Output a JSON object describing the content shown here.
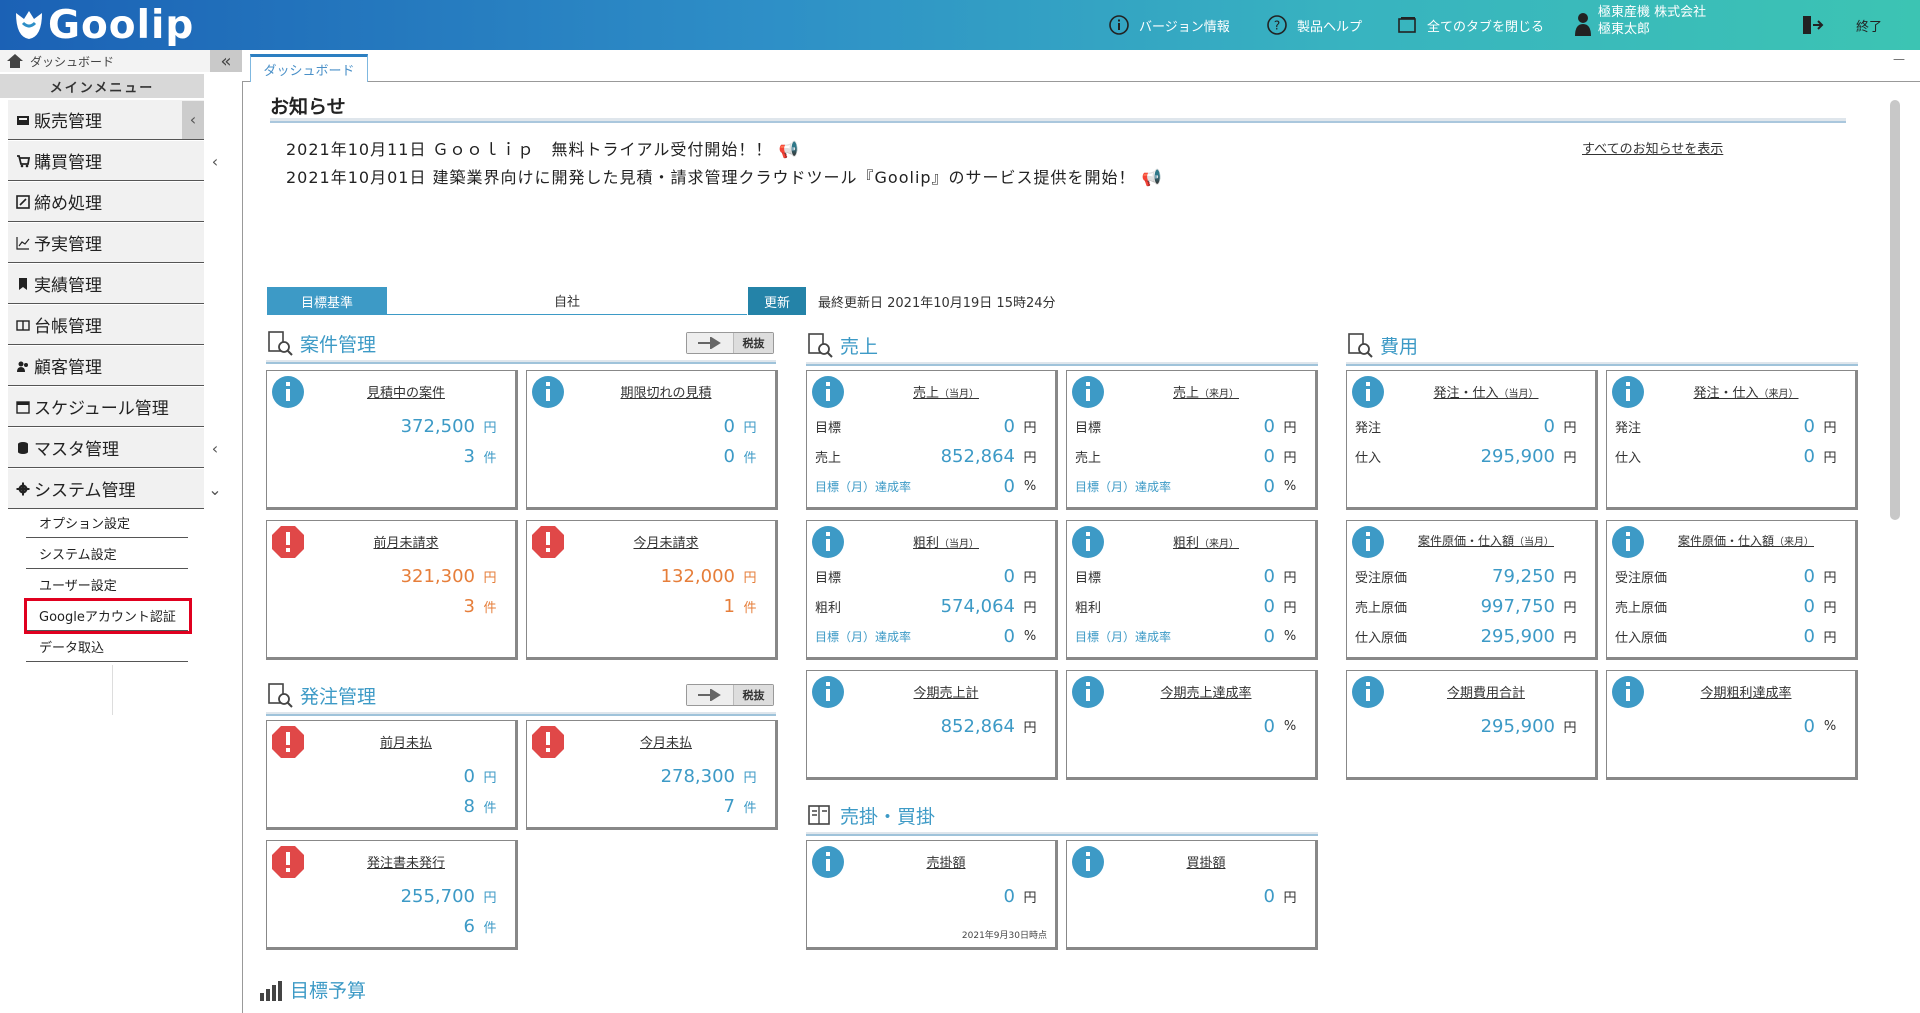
{
  "header": {
    "logo": "Goolip",
    "version_info": "バージョン情報",
    "product_help": "製品ヘルプ",
    "close_all_tabs": "全てのタブを閉じる",
    "company": "極東産機 株式会社",
    "user": "極東太郎",
    "exit": "終了"
  },
  "sidebar": {
    "dashboard_link": "ダッシュボード",
    "menu_title": "メインメニュー",
    "items": [
      {
        "label": "販売管理"
      },
      {
        "label": "購買管理"
      },
      {
        "label": "締め処理"
      },
      {
        "label": "予実管理"
      },
      {
        "label": "実績管理"
      },
      {
        "label": "台帳管理"
      },
      {
        "label": "顧客管理"
      },
      {
        "label": "スケジュール管理"
      },
      {
        "label": "マスタ管理"
      },
      {
        "label": "システム管理"
      }
    ],
    "sub_items": [
      {
        "label": "オプション設定"
      },
      {
        "label": "システム設定"
      },
      {
        "label": "ユーザー設定"
      },
      {
        "label": "Googleアカウント認証"
      },
      {
        "label": "データ取込"
      }
    ]
  },
  "tabs": [
    {
      "label": "ダッシュボード"
    }
  ],
  "notices": {
    "title": "お知らせ",
    "items": [
      "2021年10月11日 Ｇｏｏｌｉｐ　無料トライアル受付開始！！",
      "2021年10月01日 建築業界向けに開発した見積・請求管理クラウドツール『Goolip』のサービス提供を開始！"
    ],
    "show_all": "すべてのお知らせを表示"
  },
  "target": {
    "base_label": "目標基準",
    "self_label": "自社",
    "update_button": "更新",
    "last_updated": "最終更新日 2021年10月19日 15時24分"
  },
  "sections": {
    "projects": {
      "title": "案件管理",
      "tax": "税抜"
    },
    "orders": {
      "title": "発注管理",
      "tax": "税抜"
    },
    "sales": {
      "title": "売上"
    },
    "costs": {
      "title": "費用"
    },
    "receivables": {
      "title": "売掛・買掛"
    },
    "budget": {
      "title": "目標予算"
    }
  },
  "units": {
    "yen": "円",
    "count": "件",
    "percent": "%"
  },
  "labels": {
    "target": "目標",
    "sales": "売上",
    "gross": "粗利",
    "rate": "目標（月）達成率",
    "order": "発注",
    "purchase": "仕入",
    "order_cost": "受注原価",
    "sales_cost": "売上原価",
    "purchase_cost": "仕入原価"
  },
  "cards": {
    "estimating": {
      "title": "見積中の案件",
      "amount": "372,500",
      "count": "3"
    },
    "expired": {
      "title": "期限切れの見積",
      "amount": "0",
      "count": "0"
    },
    "last_unbilled": {
      "title": "前月未請求",
      "amount": "321,300",
      "count": "3"
    },
    "this_unbilled": {
      "title": "今月未請求",
      "amount": "132,000",
      "count": "1"
    },
    "last_unpaid": {
      "title": "前月未払",
      "amount": "0",
      "count": "8"
    },
    "this_unpaid": {
      "title": "今月未払",
      "amount": "278,300",
      "count": "7"
    },
    "po_unissued": {
      "title": "発注書未発行",
      "amount": "255,700",
      "count": "6"
    },
    "sales_cur": {
      "title": "売上",
      "suffix": "（当月）",
      "target": "0",
      "actual": "852,864",
      "rate": "0"
    },
    "sales_next": {
      "title": "売上",
      "suffix": "（来月）",
      "target": "0",
      "actual": "0",
      "rate": "0"
    },
    "gross_cur": {
      "title": "粗利",
      "suffix": "（当月）",
      "target": "0",
      "actual": "574,064",
      "rate": "0"
    },
    "gross_next": {
      "title": "粗利",
      "suffix": "（来月）",
      "target": "0",
      "actual": "0",
      "rate": "0"
    },
    "period_sales": {
      "title": "今期売上計",
      "amount": "852,864"
    },
    "period_sales_rate": {
      "title": "今期売上達成率",
      "rate": "0"
    },
    "order_cur": {
      "title": "発注・仕入",
      "suffix": "（当月）",
      "order": "0",
      "purchase": "295,900"
    },
    "order_next": {
      "title": "発注・仕入",
      "suffix": "（来月）",
      "order": "0",
      "purchase": "0"
    },
    "cost_cur": {
      "title": "案件原価・仕入額",
      "suffix": "（当月）",
      "order_cost": "79,250",
      "sales_cost": "997,750",
      "purchase_cost": "295,900"
    },
    "cost_next": {
      "title": "案件原価・仕入額",
      "suffix": "（来月）",
      "order_cost": "0",
      "sales_cost": "0",
      "purchase_cost": "0"
    },
    "period_cost": {
      "title": "今期費用合計",
      "amount": "295,900"
    },
    "period_gross_rate": {
      "title": "今期粗利達成率",
      "rate": "0"
    },
    "receivable": {
      "title": "売掛額",
      "amount": "0",
      "note": "2021年9月30日時点"
    },
    "payable": {
      "title": "買掛額",
      "amount": "0"
    }
  },
  "colors": {
    "accent": "#3d9ac6",
    "warning": "#e04848",
    "orange_value": "#e67e3a",
    "highlight": "#e0001f"
  }
}
